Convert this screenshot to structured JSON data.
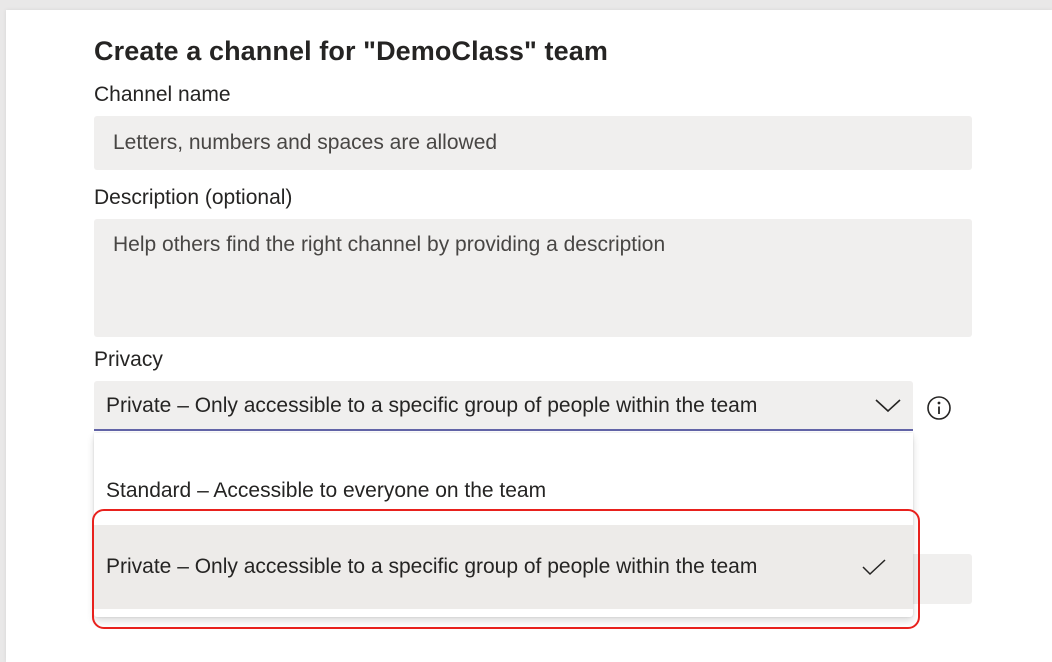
{
  "dialog": {
    "title": "Create a channel for \"DemoClass\" team"
  },
  "channel_name": {
    "label": "Channel name",
    "placeholder": "Letters, numbers and spaces are allowed",
    "value": ""
  },
  "description": {
    "label": "Description (optional)",
    "placeholder": "Help others find the right channel by providing a description",
    "value": ""
  },
  "privacy": {
    "label": "Privacy",
    "selected": "Private – Only accessible to a specific group of people within the team",
    "options": [
      {
        "label": "Standard – Accessible to everyone on the team",
        "selected": false
      },
      {
        "label": "Private – Only accessible to a specific group of people within the team",
        "selected": true
      }
    ],
    "icons": {
      "dropdown": "chevron-down-icon",
      "info": "info-icon",
      "check": "checkmark-icon"
    }
  },
  "colors": {
    "accent": "#6264a7",
    "highlight": "#e8211d",
    "field_bg": "#f0efee"
  }
}
